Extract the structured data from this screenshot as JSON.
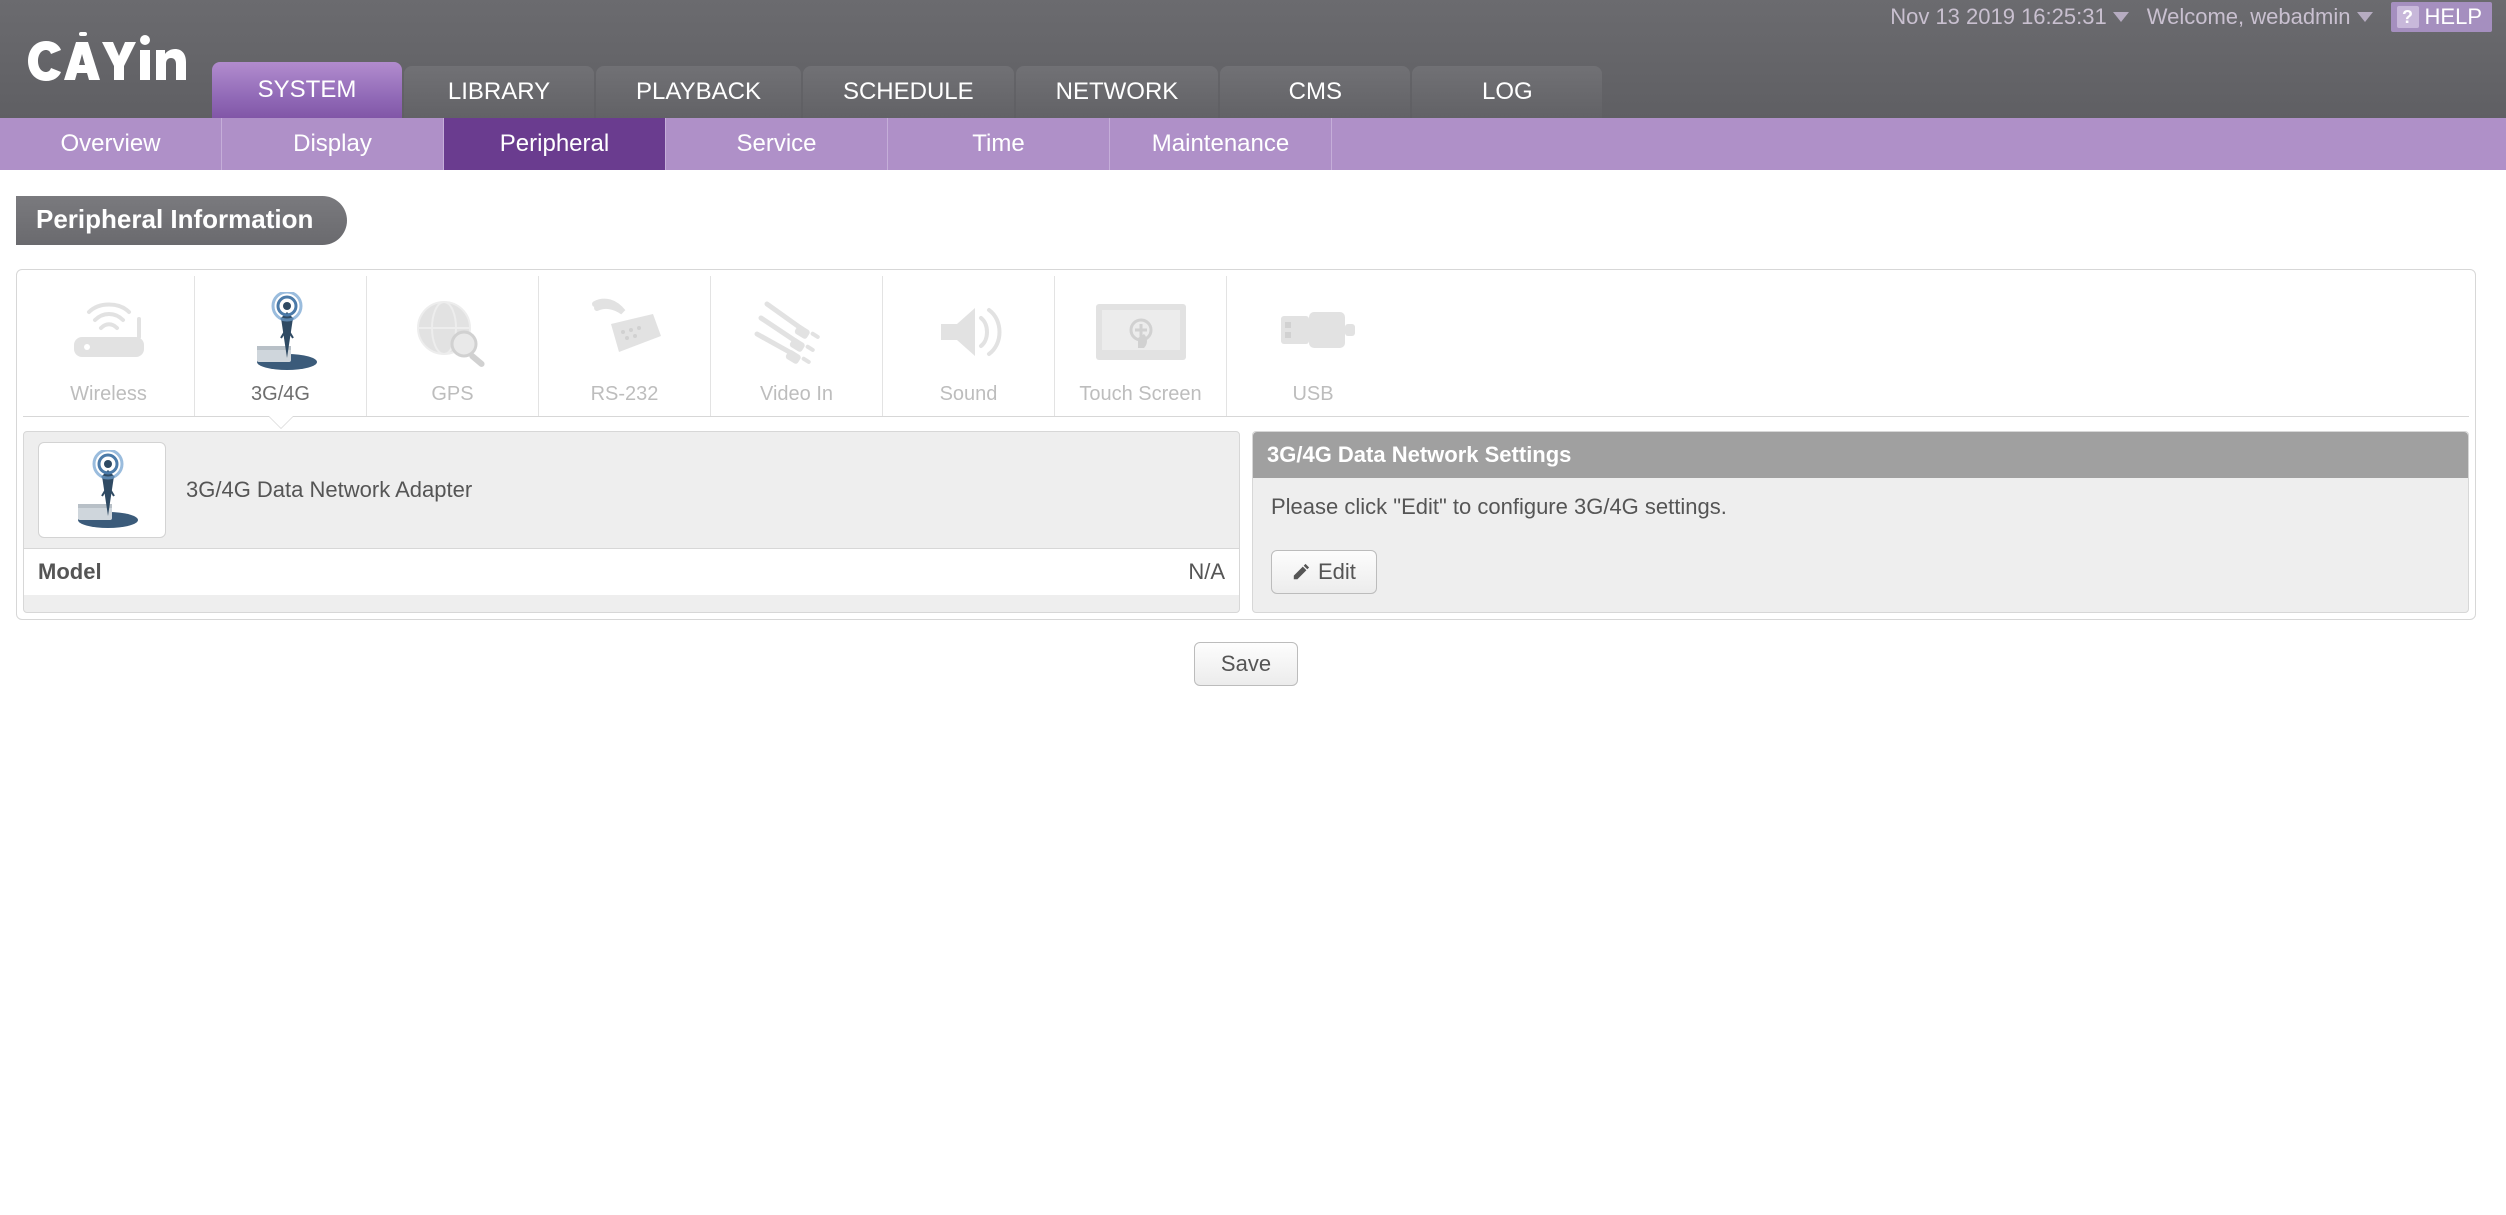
{
  "utility": {
    "datetime": "Nov 13 2019 16:25:31",
    "welcome": "Welcome, webadmin",
    "help_label": "HELP"
  },
  "logo_text": "cAYın",
  "main_tabs": [
    {
      "label": "SYSTEM",
      "active": true
    },
    {
      "label": "LIBRARY",
      "active": false
    },
    {
      "label": "PLAYBACK",
      "active": false
    },
    {
      "label": "SCHEDULE",
      "active": false
    },
    {
      "label": "NETWORK",
      "active": false
    },
    {
      "label": "CMS",
      "active": false
    },
    {
      "label": "LOG",
      "active": false
    }
  ],
  "sub_tabs": [
    {
      "label": "Overview",
      "active": false
    },
    {
      "label": "Display",
      "active": false
    },
    {
      "label": "Peripheral",
      "active": true
    },
    {
      "label": "Service",
      "active": false
    },
    {
      "label": "Time",
      "active": false
    },
    {
      "label": "Maintenance",
      "active": false
    }
  ],
  "section_title": "Peripheral Information",
  "peripheral_tabs": [
    {
      "id": "wireless",
      "label": "Wireless",
      "active": false
    },
    {
      "id": "3g4g",
      "label": "3G/4G",
      "active": true
    },
    {
      "id": "gps",
      "label": "GPS",
      "active": false
    },
    {
      "id": "rs232",
      "label": "RS-232",
      "active": false
    },
    {
      "id": "videoin",
      "label": "Video In",
      "active": false
    },
    {
      "id": "sound",
      "label": "Sound",
      "active": false
    },
    {
      "id": "touch",
      "label": "Touch Screen",
      "active": false
    },
    {
      "id": "usb",
      "label": "USB",
      "active": false
    }
  ],
  "adapter": {
    "title": "3G/4G Data Network Adapter",
    "rows": [
      {
        "label": "Model",
        "value": "N/A"
      }
    ]
  },
  "settings": {
    "header": "3G/4G Data Network Settings",
    "hint": "Please click \"Edit\" to configure 3G/4G settings.",
    "edit_label": "Edit"
  },
  "save_label": "Save"
}
